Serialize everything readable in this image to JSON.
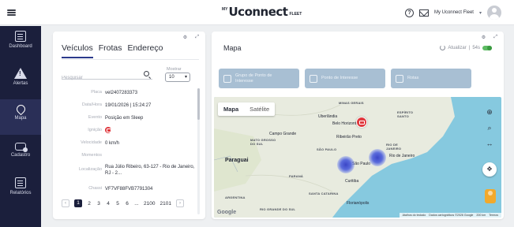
{
  "header": {
    "logo_prefix": "MY",
    "logo_main": "Uconnect",
    "logo_suffix": "FLEET",
    "help_glyph": "?",
    "user_name": "My Uconnect Fleet",
    "user_caret": "▾"
  },
  "sidebar": {
    "items": [
      {
        "label": "Dashboard",
        "icon": "dashboard-icon"
      },
      {
        "label": "Alertas",
        "icon": "alert-icon"
      },
      {
        "label": "Mapa",
        "icon": "map-pin-icon",
        "active": true
      },
      {
        "label": "Cadastro",
        "icon": "car-register-icon"
      },
      {
        "label": "Relatórios",
        "icon": "report-icon"
      }
    ]
  },
  "left_panel": {
    "tabs": [
      "Veículos",
      "Frotas",
      "Endereço"
    ],
    "search_placeholder": "Pesquisar",
    "show_label": "Mostrar",
    "show_value": "10",
    "details": [
      {
        "key": "Placa",
        "value": "vel2407283373"
      },
      {
        "key": "Data/Hora",
        "value": "19/01/2026 | 15:24:27"
      },
      {
        "key": "Evento",
        "value": "Posição em Sleep"
      },
      {
        "key": "Ignição",
        "value": ""
      },
      {
        "key": "Velocidade",
        "value": "0 km/h"
      },
      {
        "key": "Momentos",
        "value": ""
      },
      {
        "key": "Localização",
        "value": "Rua Júlio Ribeiro, 63-127 - Rio de Janeiro, RJ - 2..."
      },
      {
        "key": "Chassi",
        "value": "VF7VF88FVB7791304"
      }
    ],
    "pager": {
      "prev": "‹",
      "pages": [
        "1",
        "2",
        "3",
        "4",
        "5",
        "6"
      ],
      "ellipsis": "...",
      "tail": [
        "2100",
        "2101"
      ],
      "next": "›"
    }
  },
  "map_panel": {
    "title": "Mapa",
    "refresh_label": "Atualizar",
    "refresh_interval": "54s",
    "filters": [
      "Grupo de Ponto de Interesse",
      "Ponto de Interesse",
      "Rotas"
    ],
    "map_types": [
      "Mapa",
      "Satélite"
    ],
    "labels": {
      "minas": "MINAS GERAIS",
      "espirito": "ESPÍRITO SANTO",
      "mato": "MATO GROSSO DO SUL",
      "sao_paulo_state": "SÃO PAULO",
      "rio_state": "RIO DE JANEIRO",
      "parana": "PARANÁ",
      "santa_catarina": "SANTA CATARINA",
      "grande": "RIO GRANDE DO SUL",
      "paraguay": "Paraguai",
      "argentina": "ARGENTINA"
    },
    "cities": {
      "belo": "Belo Horizonte",
      "uberlandia": "Uberlândia",
      "campo": "Campo Grande",
      "ribeirao": "Ribeirão Preto",
      "sao_paulo": "São Paulo",
      "rio": "Rio de Janeiro",
      "curitiba": "Curitiba",
      "florianopolis": "Florianópolis"
    },
    "cluster_sp": "2",
    "cluster_rj": "3",
    "google": "Google",
    "attribution": [
      "Atalhos do teclado",
      "Dados cartográficos ©2026 Google",
      "200 km",
      "Termos"
    ]
  },
  "colors": {
    "sidebar_bg": "#1b1f3c",
    "accent": "#2b3a8c",
    "marker_red": "#e0393e",
    "water": "#86c9df",
    "land": "#e8ebdf"
  }
}
